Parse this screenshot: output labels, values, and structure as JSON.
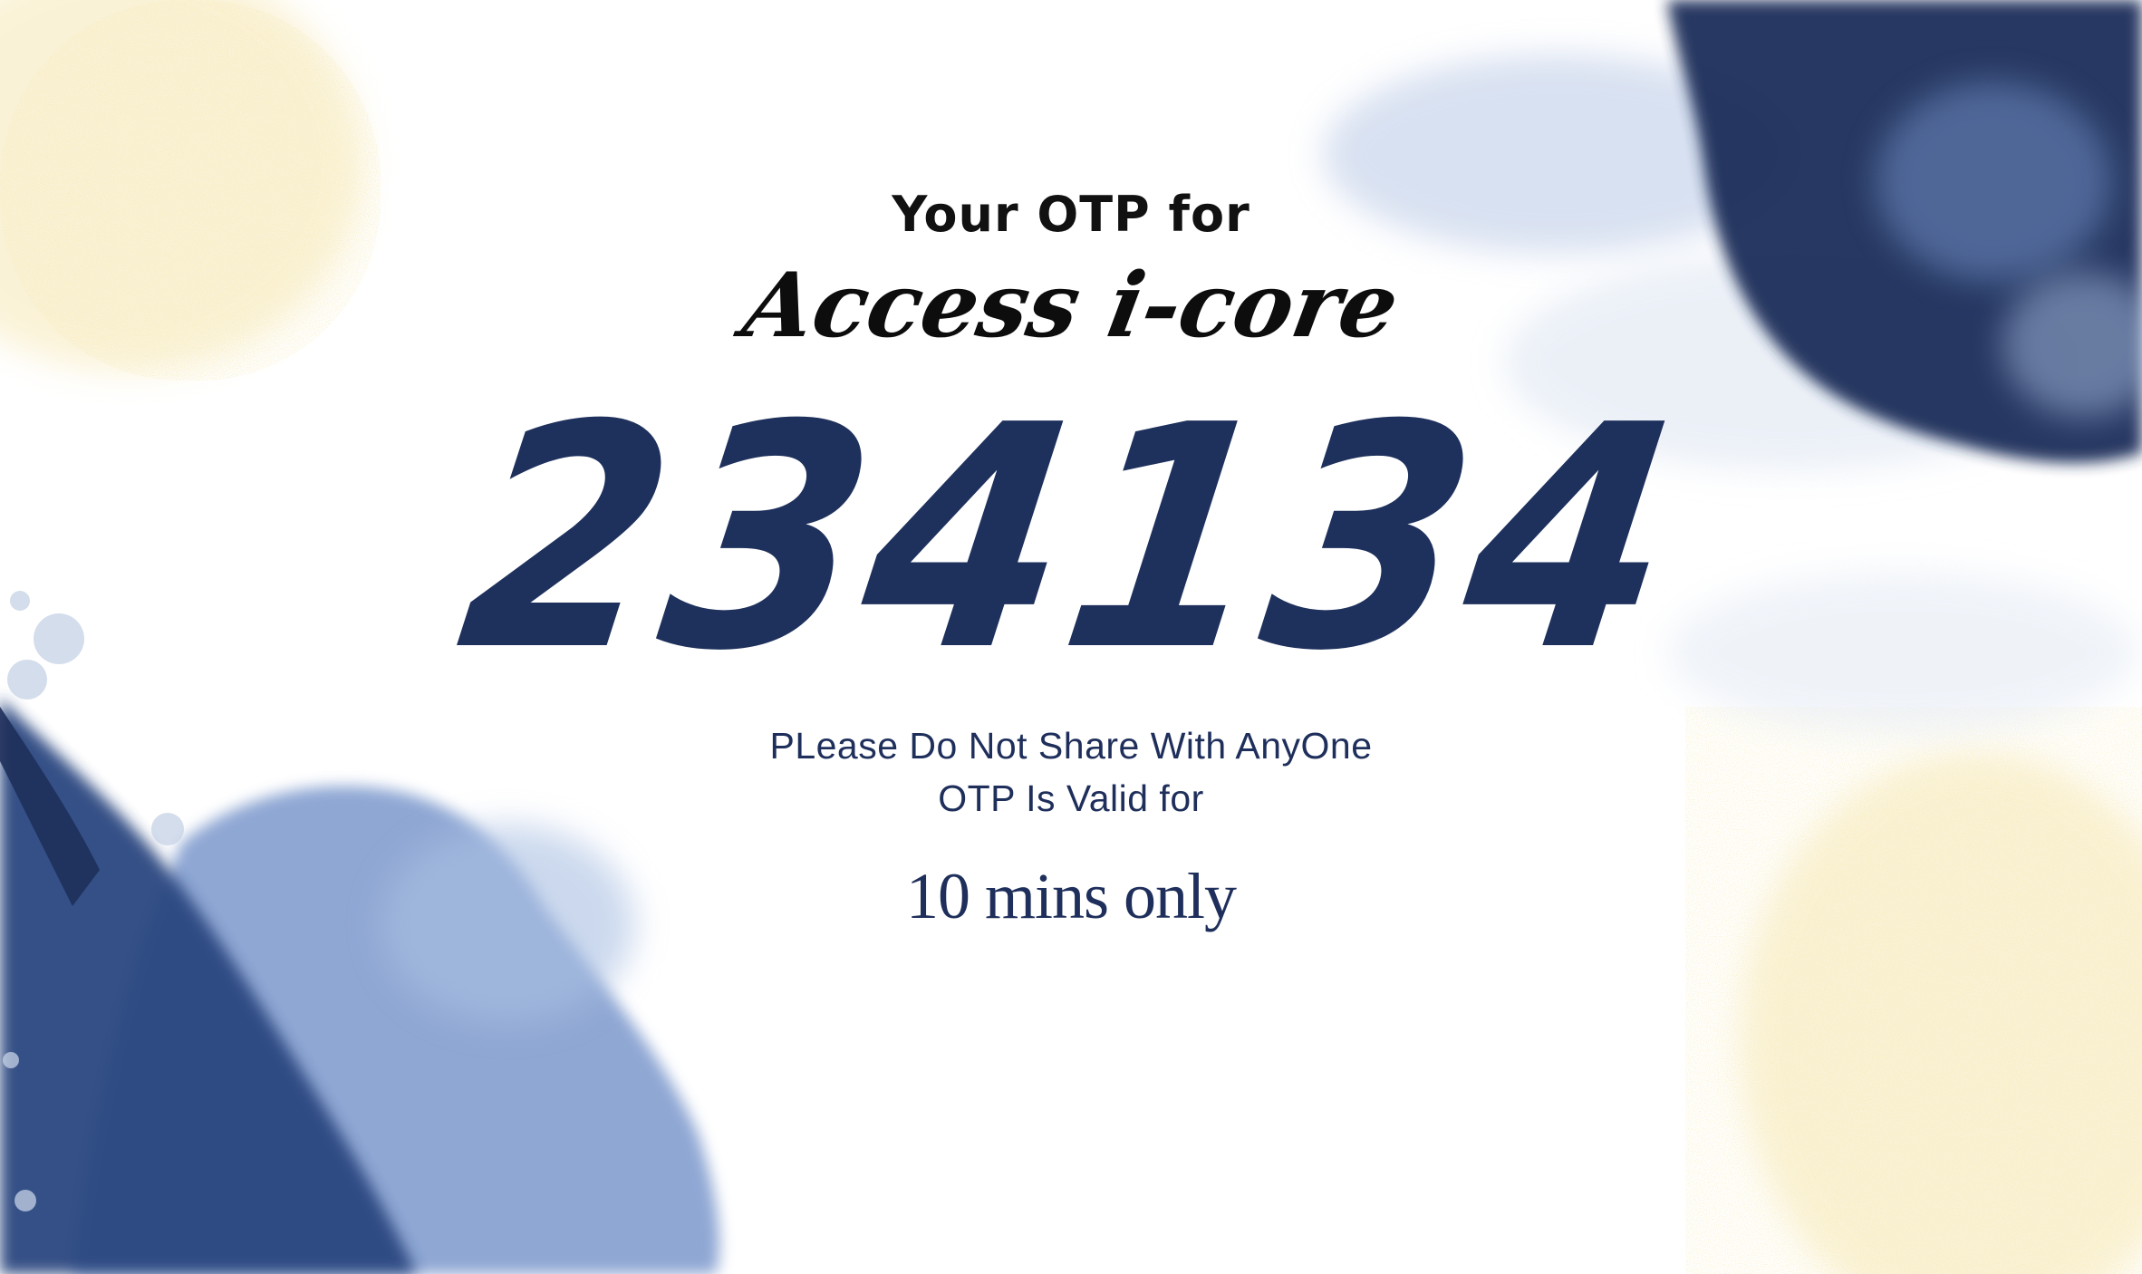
{
  "otp_card": {
    "intro": "Your OTP for",
    "app_name": "Access i-core",
    "code": "234134",
    "warning": "PLease Do Not Share With AnyOne",
    "validity": "OTP Is Valid for",
    "duration": "10 mins only"
  },
  "decor": {
    "navy": "#1e2f5a",
    "mid_blue": "#4a6fb0",
    "light_blue": "#8fa9d6",
    "gold": "#e8c65a"
  }
}
